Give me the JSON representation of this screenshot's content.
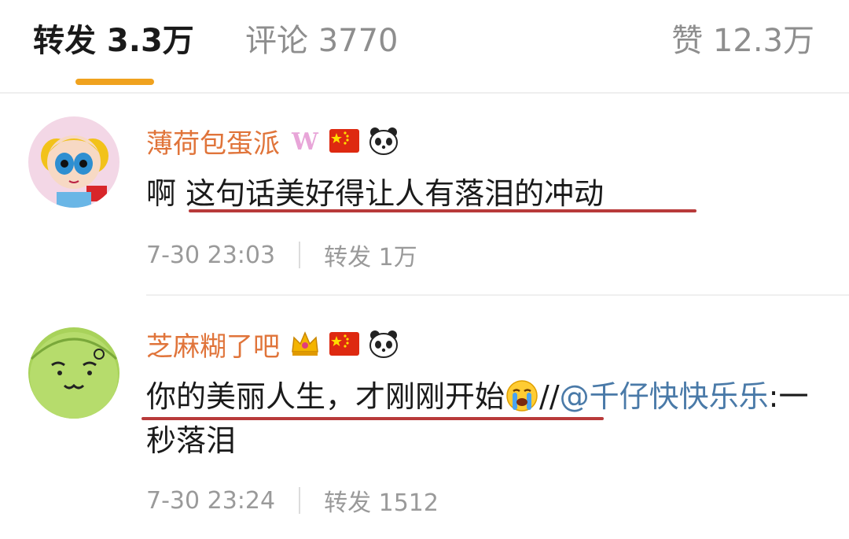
{
  "tabs": {
    "repost": "转发 3.3万",
    "comments": "评论 3770",
    "likes": "赞 12.3万"
  },
  "comments": [
    {
      "username": "薄荷包蛋派",
      "badges": [
        "weibo-w-badge-icon",
        "china-flag-icon",
        "panda-icon"
      ],
      "text": "啊 这句话美好得让人有落泪的冲动",
      "time": "7-30 23:03",
      "repost": "转发 1万"
    },
    {
      "username": "芝麻糊了吧",
      "badges": [
        "crown-badge-icon",
        "china-flag-icon",
        "panda-icon"
      ],
      "text_main": "你的美丽人生，才刚刚开始",
      "emoji": "crying-face-icon",
      "text_sep": "//",
      "mention": "@千仔快快乐乐",
      "text_tail": ":一秒落泪",
      "time": "7-30 23:24",
      "repost": "转发 1512"
    }
  ],
  "colors": {
    "tab_underline": "#f0a21e",
    "username": "#e0743a",
    "mention": "#4a7aa8",
    "red_underline": "#b83a3a"
  }
}
